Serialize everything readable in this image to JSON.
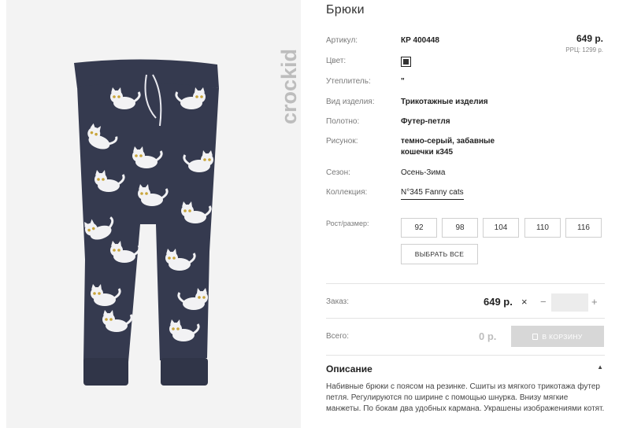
{
  "product": {
    "title": "Брюки",
    "brand": "crockid",
    "price": "649 р.",
    "rrp": "РРЦ: 1299 р."
  },
  "specs": [
    {
      "label": "Артикул:",
      "value": "КР 400448"
    },
    {
      "label": "Цвет:",
      "value": ""
    },
    {
      "label": "Утеплитель:",
      "value": "\""
    },
    {
      "label": "Вид изделия:",
      "value": "Трикотажные изделия"
    },
    {
      "label": "Полотно:",
      "value": "Футер-петля"
    },
    {
      "label": "Рисунок:",
      "value": "темно-серый, забавные",
      "value2": "кошечки к345"
    },
    {
      "label": "Сезон:",
      "value": "Осень-Зима"
    },
    {
      "label": "Коллекция:",
      "value": "N°345 Fanny cats"
    }
  ],
  "colors": {
    "swatch": "#333333",
    "button_disabled": "#d7d7d7",
    "image_bg": "#f3f3f3",
    "fabric": "#353a4f"
  },
  "sizes": {
    "label": "Рост/размер:",
    "options": [
      "92",
      "98",
      "104",
      "110",
      "116"
    ],
    "select_all": "ВЫБРАТЬ ВСЕ"
  },
  "order": {
    "label": "Заказ:",
    "price": "649 р.",
    "times": "×",
    "minus": "−",
    "plus": "+",
    "qty": ""
  },
  "total": {
    "label": "Всего:",
    "value": "0 р.",
    "cart_button": "В КОРЗИНУ"
  },
  "description": {
    "title": "Описание",
    "text": "Набивные брюки с поясом на резинке. Сшиты из мягкого трикотажа футер петля. Регулируются по ширине с помощью шнурка. Внизу мягкие манжеты. По бокам два удобных кармана. Украшены изображениями котят.",
    "caret": "▲"
  }
}
